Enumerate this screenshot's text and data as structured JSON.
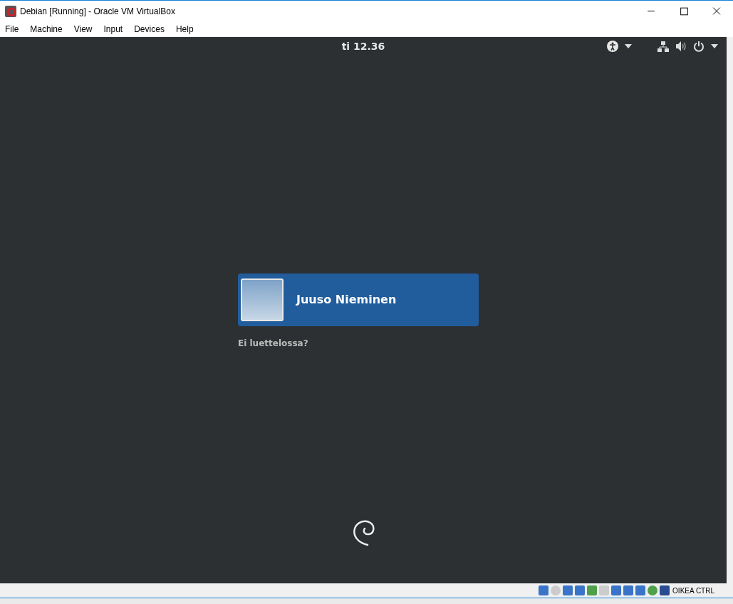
{
  "window": {
    "title": "Debian [Running] - Oracle VM VirtualBox"
  },
  "menu": [
    "File",
    "Machine",
    "View",
    "Input",
    "Devices",
    "Help"
  ],
  "top_bar": {
    "clock": "ti 12.36"
  },
  "login": {
    "users": [
      {
        "name": "Juuso Nieminen",
        "selected": true
      }
    ],
    "not_listed": "Ei luettelossa?"
  },
  "status_bar": {
    "host_key": "OIKEA CTRL"
  }
}
